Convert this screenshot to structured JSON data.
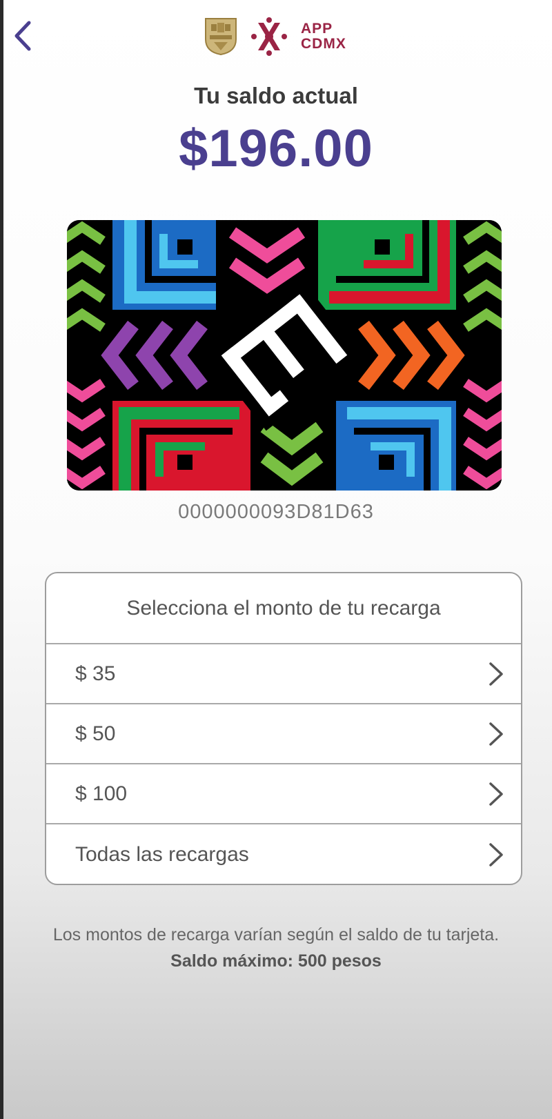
{
  "header": {
    "back_icon": "chevron-left-icon",
    "app_label_line1": "APP",
    "app_label_line2": "CDMX",
    "colors": {
      "brand": "#9a2445",
      "back": "#4a3f8f"
    }
  },
  "balance": {
    "label": "Tu saldo actual",
    "value": "$196.00",
    "color": "#4a3f8f"
  },
  "card": {
    "number": "0000000093D81D63"
  },
  "recharge": {
    "title": "Selecciona el monto de tu recarga",
    "options": [
      {
        "label": "$ 35",
        "icon": "chevron-right-icon"
      },
      {
        "label": "$ 50",
        "icon": "chevron-right-icon"
      },
      {
        "label": "$ 100",
        "icon": "chevron-right-icon"
      },
      {
        "label": "Todas las recargas",
        "icon": "chevron-right-icon"
      }
    ]
  },
  "note": {
    "text": "Los montos de recarga varían según el saldo de tu tarjeta.",
    "bold": "Saldo máximo: 500 pesos"
  }
}
